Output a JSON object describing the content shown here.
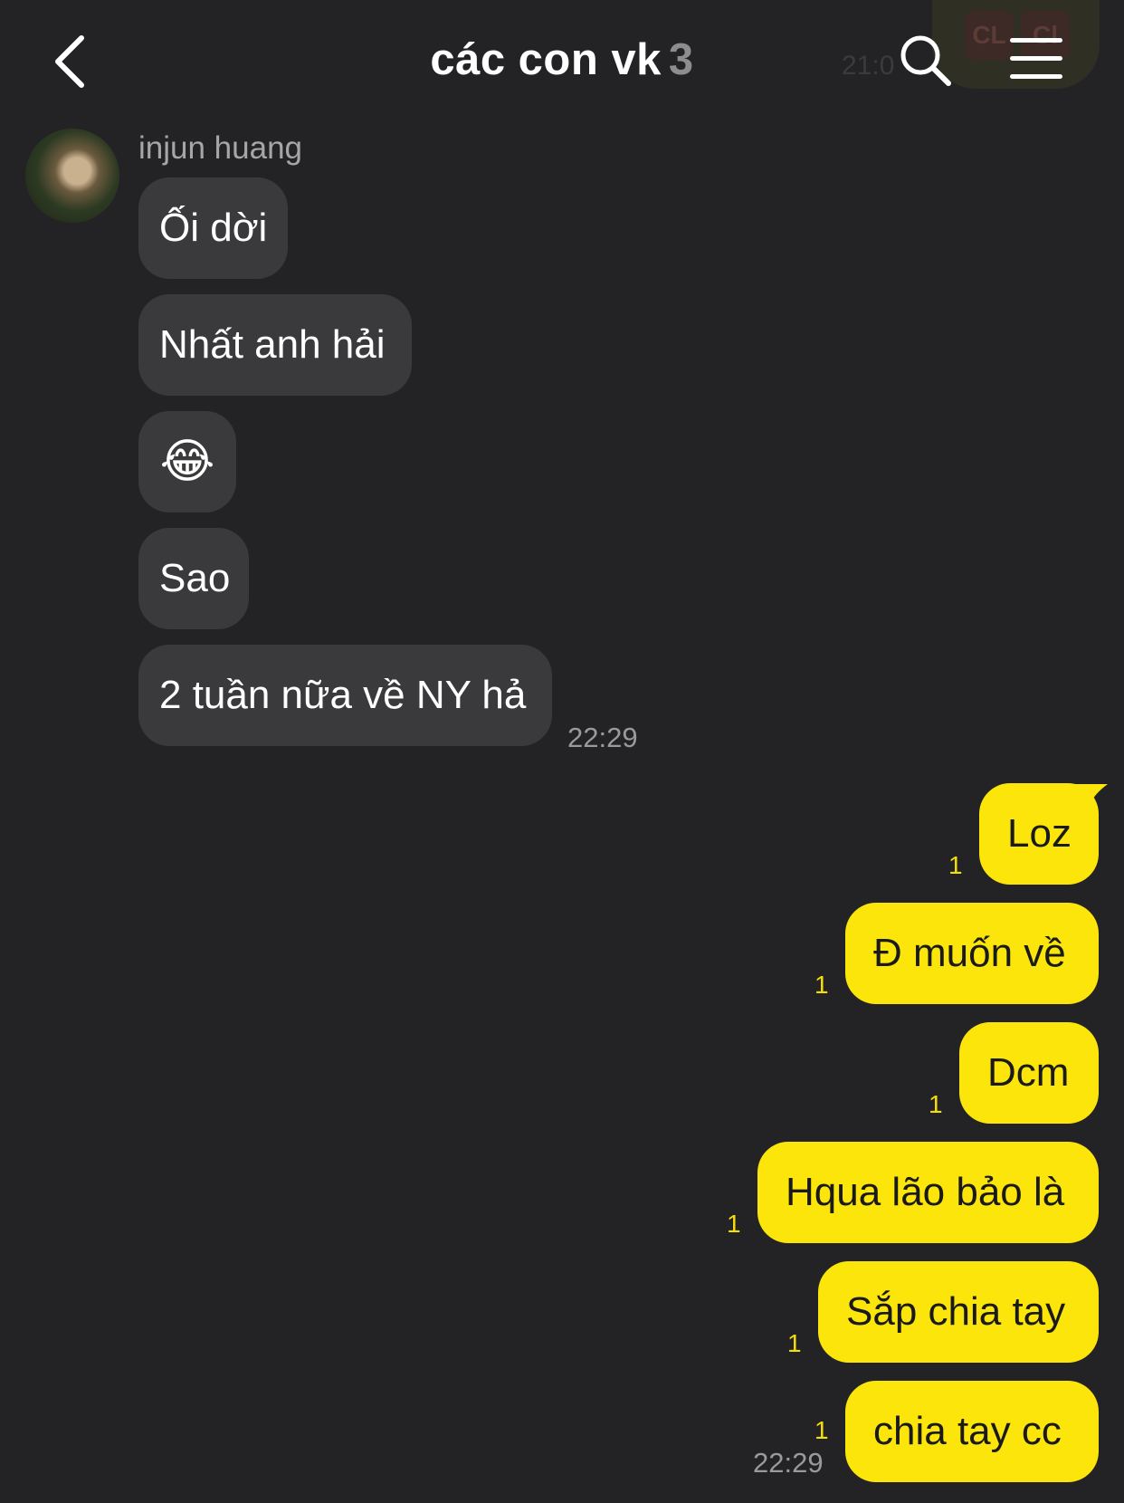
{
  "header": {
    "title": "các con vk",
    "member_count": "3",
    "ghost_time": "21:0",
    "ghost_badges": [
      "CL",
      "Cl"
    ],
    "icons": {
      "back": "chevron-left-icon",
      "search": "search-icon",
      "menu": "hamburger-menu-icon"
    }
  },
  "received": {
    "sender": "injun huang",
    "messages": [
      {
        "text": "Ối dời"
      },
      {
        "text": "Nhất anh hải"
      },
      {
        "text": "😂",
        "icon": "face-with-tears-of-joy-icon"
      },
      {
        "text": "Sao"
      },
      {
        "text": "2 tuần nữa về NY hả"
      }
    ],
    "time": "22:29"
  },
  "sent": {
    "messages": [
      {
        "text": "Loz",
        "unread": "1"
      },
      {
        "text": "Đ muốn về",
        "unread": "1"
      },
      {
        "text": "Dcm",
        "unread": "1"
      },
      {
        "text": "Hqua lão bảo là",
        "unread": "1"
      },
      {
        "text": "Sắp chia tay",
        "unread": "1"
      },
      {
        "text": "chia tay cc",
        "unread": "1"
      }
    ],
    "time": "22:29"
  },
  "colors": {
    "background": "#232325",
    "received_bubble": "#3a3a3c",
    "sent_bubble": "#fbe50b",
    "unread_count": "#f5dd0a"
  }
}
